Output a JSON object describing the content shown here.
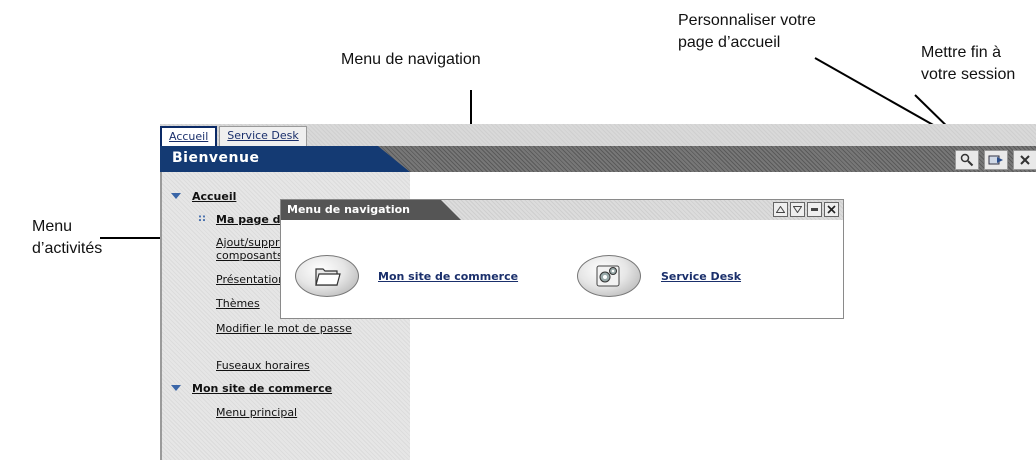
{
  "callouts": {
    "customize": [
      "Personnaliser votre",
      "page d’accueil"
    ],
    "navigation": "Menu de navigation",
    "logout": [
      "Mettre fin à",
      "votre session"
    ],
    "activity": [
      "Menu",
      "d’activités"
    ]
  },
  "tabs": [
    {
      "label": "Accueil",
      "active": true
    },
    {
      "label": "Service Desk",
      "active": false
    }
  ],
  "header": {
    "title": "Bienvenue",
    "icons": [
      "customize-icon",
      "logout-icon",
      "close-icon"
    ]
  },
  "sidebar": {
    "sections": [
      {
        "label": "Accueil",
        "items": [
          {
            "label": "Ma page d'accueil",
            "current": true
          },
          {
            "label": "Ajout/suppression de composants"
          },
          {
            "label": "Présentation"
          },
          {
            "label": "Thèmes"
          },
          {
            "label": "Modifier le mot de passe"
          },
          {
            "label": "Fuseaux horaires"
          }
        ]
      },
      {
        "label": "Mon site de commerce",
        "items": [
          {
            "label": "Menu principal"
          }
        ]
      }
    ]
  },
  "portlet": {
    "title": "Menu de navigation",
    "controls": [
      "restore-icon",
      "minimize-icon",
      "maximize-icon",
      "close-icon"
    ],
    "links": [
      {
        "label": "Mon site de commerce",
        "icon": "folder-icon"
      },
      {
        "label": "Service Desk",
        "icon": "gears-icon"
      }
    ]
  },
  "colors": {
    "nav_blue": "#143a73",
    "link": "#1a2f6b",
    "sidebar_marker": "#3a66a8"
  }
}
